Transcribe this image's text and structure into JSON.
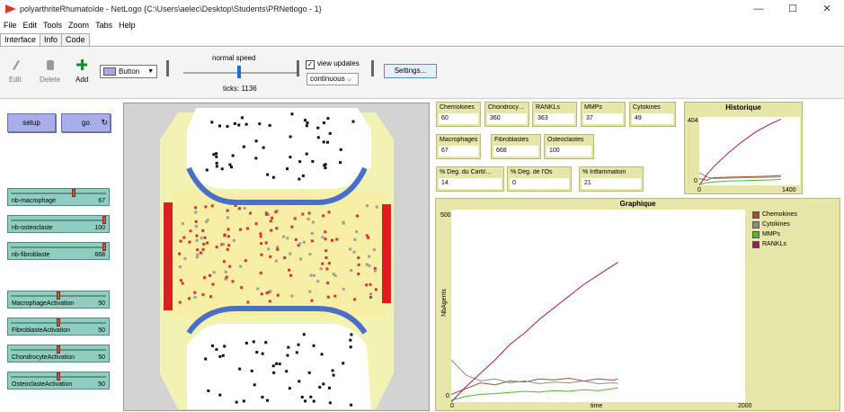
{
  "window": {
    "title": "polyarthriteRhumatoïde - NetLogo {C:\\Users\\aelec\\Desktop\\Students\\PRNetlogo - 1}",
    "minimize": "—",
    "maximize": "☐",
    "close": "✕"
  },
  "menu": [
    "File",
    "Edit",
    "Tools",
    "Zoom",
    "Tabs",
    "Help"
  ],
  "tabs": [
    "Interface",
    "Info",
    "Code"
  ],
  "toolbar": {
    "edit_label": "Edit",
    "delete_label": "Delete",
    "add_label": "Add",
    "widget_type": "Button",
    "speed_label": "normal speed",
    "ticks_text": "ticks: 1136",
    "view_updates_label": "view updates",
    "update_mode": "continuous",
    "settings_label": "Settings..."
  },
  "buttons": {
    "setup": "setup",
    "go": "go"
  },
  "sliders": [
    {
      "name": "nb-macrophage",
      "value": "67",
      "fraction": 0.67
    },
    {
      "name": "nb-osteoclaste",
      "value": "100",
      "fraction": 1.0
    },
    {
      "name": "nb-fibroblaste",
      "value": "668",
      "fraction": 1.0
    },
    {
      "name": "MacrophageActivation",
      "value": "50",
      "fraction": 0.5
    },
    {
      "name": "FibroblasteActivation",
      "value": "50",
      "fraction": 0.5
    },
    {
      "name": "ChondrocyteActivation",
      "value": "50",
      "fraction": 0.5
    },
    {
      "name": "OsteoclasteActivation",
      "value": "50",
      "fraction": 0.5
    }
  ],
  "monitors": [
    {
      "label": "Chemokines",
      "value": "60"
    },
    {
      "label": "Chondrocy…",
      "value": "360"
    },
    {
      "label": "RANKLs",
      "value": "363"
    },
    {
      "label": "MMPs",
      "value": "37"
    },
    {
      "label": "Cytokines",
      "value": "49"
    },
    {
      "label": "Macrophages",
      "value": "67"
    },
    {
      "label": "Fibroblastes",
      "value": "668"
    },
    {
      "label": "Osteoclastes",
      "value": "100"
    },
    {
      "label": "% Deg. du Cartil…",
      "value": "14"
    },
    {
      "label": "% Deg. de l'Os",
      "value": "0"
    },
    {
      "label": "% Inflammation",
      "value": "21"
    }
  ],
  "colors": {
    "chemokines": "#a0522d",
    "cytokines": "#8c8c8c",
    "mmps": "#4cba2c",
    "rankls": "#a3165d",
    "button": "#a9aee8",
    "slider": "#8ecdbf",
    "monitor": "#e6e6a8"
  },
  "chart_data": [
    {
      "type": "line",
      "title": "Historique",
      "xlim": [
        0,
        1400
      ],
      "ylim": [
        0,
        404
      ],
      "x_tick_labels": [
        "0",
        "1400"
      ],
      "y_tick_labels": [
        "0",
        "404"
      ],
      "series": [
        {
          "name": "Chemokines",
          "x": [
            0,
            100,
            200,
            400,
            600,
            800,
            1000,
            1136
          ],
          "y": [
            40,
            30,
            45,
            48,
            50,
            52,
            55,
            58
          ]
        },
        {
          "name": "Cytokines",
          "x": [
            0,
            100,
            200,
            400,
            600,
            800,
            1000,
            1136
          ],
          "y": [
            75,
            50,
            40,
            42,
            45,
            47,
            48,
            50
          ]
        },
        {
          "name": "MMPs",
          "x": [
            0,
            100,
            200,
            400,
            600,
            800,
            1000,
            1136
          ],
          "y": [
            5,
            15,
            20,
            25,
            27,
            30,
            32,
            35
          ]
        },
        {
          "name": "RANKLs",
          "x": [
            0,
            100,
            200,
            400,
            600,
            800,
            1000,
            1136
          ],
          "y": [
            0,
            60,
            110,
            190,
            260,
            320,
            365,
            390
          ]
        }
      ]
    },
    {
      "type": "line",
      "title": "Graphique",
      "xlabel": "time",
      "ylabel": "NbAgents",
      "xlim": [
        0,
        2000
      ],
      "ylim": [
        0,
        500
      ],
      "x_tick_labels": [
        "0",
        "2000"
      ],
      "y_tick_labels": [
        "0",
        "500"
      ],
      "series": [
        {
          "name": "Chemokines",
          "x": [
            0,
            100,
            200,
            300,
            400,
            500,
            600,
            700,
            800,
            900,
            1000,
            1100,
            1136
          ],
          "y": [
            20,
            35,
            50,
            45,
            55,
            52,
            60,
            58,
            62,
            55,
            60,
            57,
            60
          ]
        },
        {
          "name": "Cytokines",
          "x": [
            0,
            50,
            100,
            200,
            300,
            400,
            500,
            600,
            700,
            800,
            900,
            1000,
            1100,
            1136
          ],
          "y": [
            110,
            90,
            70,
            55,
            60,
            50,
            55,
            48,
            52,
            50,
            55,
            48,
            50,
            49
          ]
        },
        {
          "name": "MMPs",
          "x": [
            0,
            100,
            200,
            300,
            400,
            500,
            600,
            700,
            800,
            900,
            1000,
            1100,
            1136
          ],
          "y": [
            5,
            15,
            20,
            22,
            25,
            28,
            26,
            30,
            28,
            32,
            30,
            35,
            37
          ]
        },
        {
          "name": "RANKLs",
          "x": [
            0,
            50,
            100,
            200,
            300,
            400,
            500,
            600,
            700,
            800,
            900,
            1000,
            1100,
            1136
          ],
          "y": [
            0,
            20,
            40,
            75,
            110,
            150,
            180,
            215,
            245,
            275,
            305,
            330,
            355,
            363
          ]
        }
      ]
    }
  ]
}
